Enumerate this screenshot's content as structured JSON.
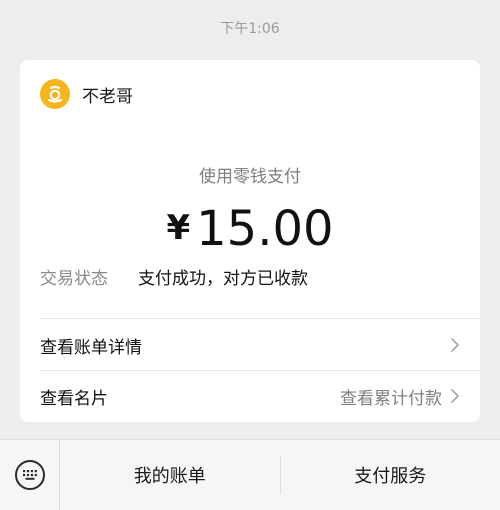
{
  "timestamp": "下午1:06",
  "card": {
    "merchant": {
      "name": "不老哥",
      "logo_icon": "merchant-logo-icon",
      "logo_color": "#f5b51e"
    },
    "pay_method": "使用零钱支付",
    "amount": {
      "currency_symbol": "¥",
      "value": "15.00"
    },
    "status": {
      "label": "交易状态",
      "value": "支付成功，对方已收款"
    },
    "rows": [
      {
        "label": "查看账单详情",
        "right_text": "",
        "icon": "chevron-right-icon"
      },
      {
        "label": "查看名片",
        "right_text": "查看累计付款",
        "icon": "chevron-right-icon"
      }
    ]
  },
  "bottom_bar": {
    "keyboard_icon": "keyboard-icon",
    "menu": [
      {
        "label": "我的账单"
      },
      {
        "label": "支付服务"
      }
    ]
  }
}
